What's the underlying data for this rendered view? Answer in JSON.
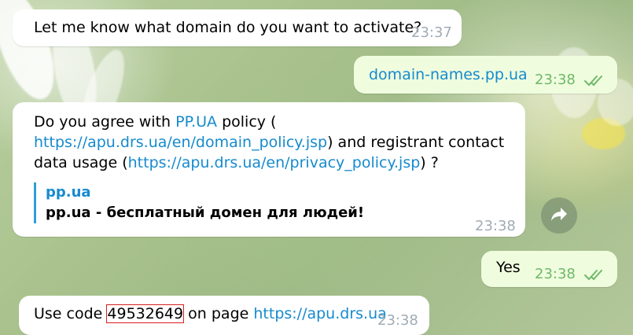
{
  "messages": [
    {
      "id": "m1",
      "direction": "in",
      "text": "Let me know what domain do you want to activate?",
      "time": "23:37"
    },
    {
      "id": "m2",
      "direction": "out",
      "text": "domain-names.pp.ua",
      "time": "23:38",
      "status": "read"
    },
    {
      "id": "m3",
      "direction": "in",
      "parts": {
        "p1": "Do you agree with ",
        "link1": "PP.UA",
        "p2": " policy (",
        "link2": "https://apu.drs.ua/en/domain_policy.jsp",
        "p3": ") and registrant contact",
        "p4": "data usage (",
        "link3": "https://apu.drs.ua/en/privacy_policy.jsp",
        "p5": ") ?"
      },
      "preview": {
        "site": "pp.ua",
        "title": "pp.ua - бесплатный домен для людей!"
      },
      "time": "23:38"
    },
    {
      "id": "m4",
      "direction": "out",
      "text": "Yes",
      "time": "23:38",
      "status": "read"
    },
    {
      "id": "m5",
      "direction": "in",
      "parts": {
        "p1": "Use code ",
        "code": "49532649",
        "p2": " on page ",
        "link": "https://apu.drs.ua"
      },
      "time": "23:38"
    }
  ],
  "colors": {
    "incoming_bubble": "#ffffff",
    "outgoing_bubble": "#effdde",
    "link": "#168acd",
    "outgoing_time": "#6fb86a",
    "incoming_time": "#a0acb6",
    "code_highlight": "#d81e1e"
  },
  "icons": {
    "forward": "forward-arrow-icon",
    "read_status": "double-check-icon"
  }
}
